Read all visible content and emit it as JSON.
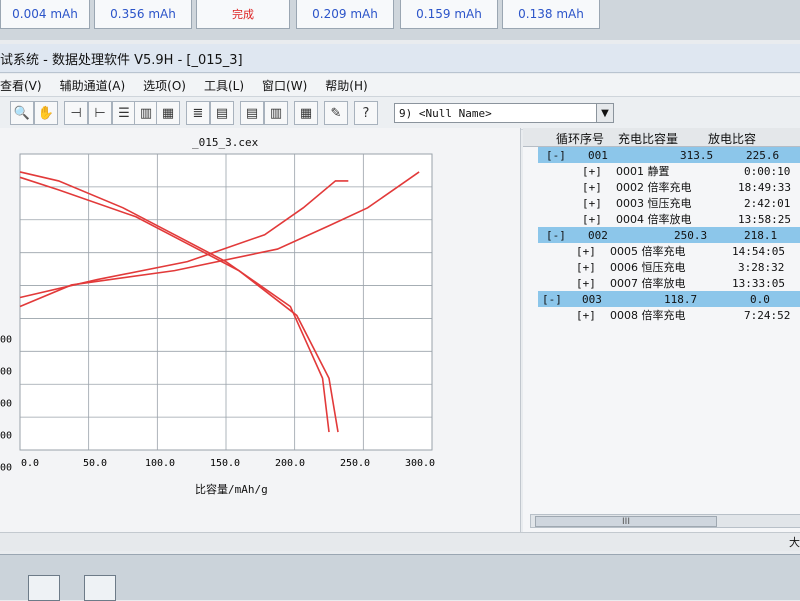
{
  "top_channels": [
    {
      "text": "0.004 mAh",
      "color": "#2b54c9"
    },
    {
      "text": "0.356 mAh",
      "color": "#2b54c9"
    },
    {
      "text": "完成",
      "color": "#d22"
    },
    {
      "text": "0.209 mAh",
      "color": "#2b54c9"
    },
    {
      "text": "0.159 mAh",
      "color": "#2b54c9"
    },
    {
      "text": "0.138 mAh",
      "color": "#2b54c9"
    }
  ],
  "window_title": "试系统 - 数据处理软件 V5.9H - [_015_3]",
  "menu": [
    "查看(V)",
    "辅助通道(A)",
    "选项(O)",
    "工具(L)",
    "窗口(W)",
    "帮助(H)"
  ],
  "toolbar": {
    "combo_value": "9) <Null Name>"
  },
  "chart_data": {
    "type": "line",
    "title": "_015_3.cex",
    "xlabel": "比容量/mAh/g",
    "x_ticks": [
      "0.0",
      "50.0",
      "100.0",
      "150.0",
      "200.0",
      "250.0",
      "300.0"
    ],
    "y_ticks": [
      "",
      "",
      "00",
      "00",
      "00",
      "00",
      "000"
    ],
    "series": [
      {
        "color": "#e23a3a",
        "points": [
          [
            0,
            4.15
          ],
          [
            30,
            4.1
          ],
          [
            80,
            3.95
          ],
          [
            120,
            3.8
          ],
          [
            160,
            3.65
          ],
          [
            210,
            3.4
          ],
          [
            235,
            3.0
          ],
          [
            240,
            2.7
          ]
        ]
      },
      {
        "color": "#e23a3a",
        "points": [
          [
            0,
            4.12
          ],
          [
            30,
            4.05
          ],
          [
            90,
            3.9
          ],
          [
            130,
            3.75
          ],
          [
            170,
            3.6
          ],
          [
            215,
            3.35
          ],
          [
            240,
            3.0
          ],
          [
            247,
            2.7
          ]
        ]
      },
      {
        "color": "#e23a3a",
        "points": [
          [
            0,
            3.4
          ],
          [
            40,
            3.52
          ],
          [
            120,
            3.6
          ],
          [
            200,
            3.72
          ],
          [
            240,
            3.85
          ],
          [
            270,
            3.95
          ],
          [
            300,
            4.1
          ],
          [
            310,
            4.15
          ]
        ]
      },
      {
        "color": "#e23a3a",
        "points": [
          [
            0,
            3.45
          ],
          [
            60,
            3.55
          ],
          [
            130,
            3.65
          ],
          [
            190,
            3.8
          ],
          [
            220,
            3.95
          ],
          [
            245,
            4.1
          ],
          [
            255,
            4.1
          ]
        ]
      }
    ]
  },
  "tree": {
    "headers": [
      "循环序号",
      "充电比容量",
      "放电比容"
    ],
    "groups": [
      {
        "toggle": "[-]",
        "id": "001",
        "charge": "313.5",
        "discharge": "225.6",
        "items": [
          {
            "toggle": "[+]",
            "label": "0001 静置",
            "time": "0:00:10"
          },
          {
            "toggle": "[+]",
            "label": "0002 倍率充电",
            "time": "18:49:33"
          },
          {
            "toggle": "[+]",
            "label": "0003 恒压充电",
            "time": "2:42:01"
          },
          {
            "toggle": "[+]",
            "label": "0004 倍率放电",
            "time": "13:58:25"
          }
        ]
      },
      {
        "toggle": "[-]",
        "id": "002",
        "charge": "250.3",
        "discharge": "218.1",
        "items": [
          {
            "toggle": "[+]",
            "label": "0005 倍率充电",
            "time": "14:54:05"
          },
          {
            "toggle": "[+]",
            "label": "0006 恒压充电",
            "time": "3:28:32"
          },
          {
            "toggle": "[+]",
            "label": "0007 倍率放电",
            "time": "13:33:05"
          }
        ]
      },
      {
        "toggle": "[-]",
        "id": "003",
        "charge": "118.7",
        "discharge": "0.0",
        "items": [
          {
            "toggle": "[+]",
            "label": "0008 倍率充电",
            "time": "7:24:52"
          }
        ]
      }
    ]
  },
  "scroll_thumb": "III",
  "status_right": "大"
}
